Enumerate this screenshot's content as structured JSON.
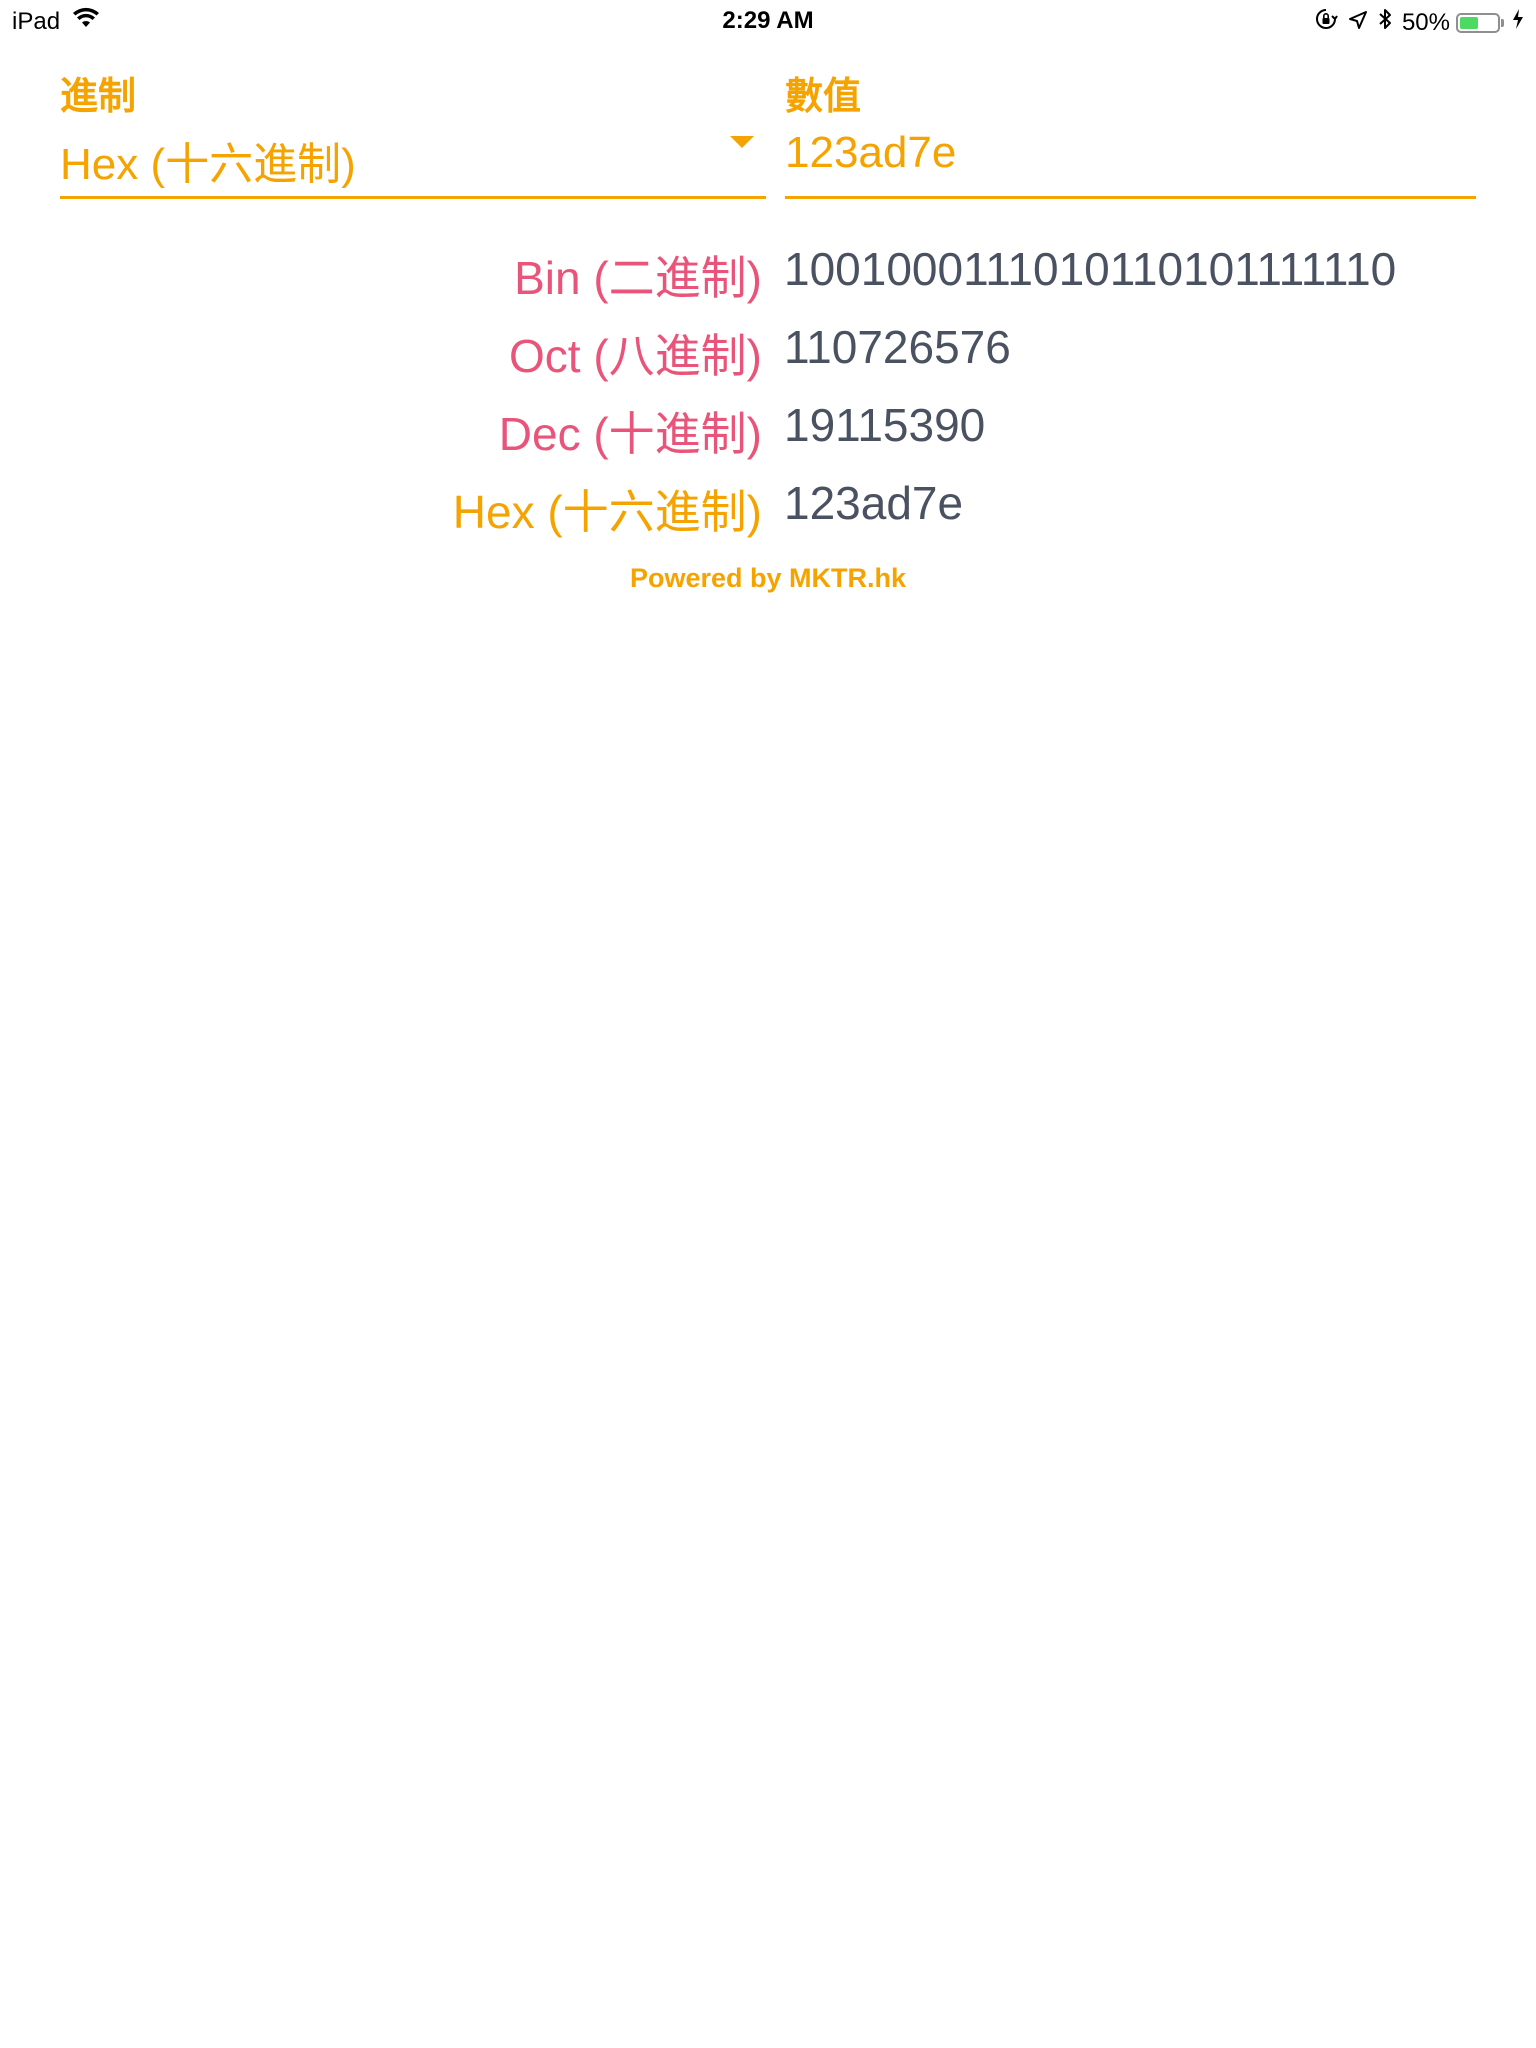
{
  "colors": {
    "accent": "#F5A300",
    "label_pink": "#E9557A",
    "value_gray": "#4A5262",
    "battery_green": "#4CD964"
  },
  "status_bar": {
    "device": "iPad",
    "time": "2:29 AM",
    "battery": "50%",
    "battery_level": 0.5
  },
  "form": {
    "base_label": "進制",
    "base_selected": "Hex (十六進制)",
    "value_label": "數值",
    "value_input": "123ad7e"
  },
  "results": [
    {
      "label": "Bin (二進制)",
      "value": "1001000111010110101111110",
      "highlight": false
    },
    {
      "label": "Oct (八進制)",
      "value": "110726576",
      "highlight": false
    },
    {
      "label": "Dec (十進制)",
      "value": "19115390",
      "highlight": false
    },
    {
      "label": "Hex (十六進制)",
      "value": "123ad7e",
      "highlight": true
    }
  ],
  "footer": {
    "powered_by": "Powered by MKTR.hk"
  }
}
